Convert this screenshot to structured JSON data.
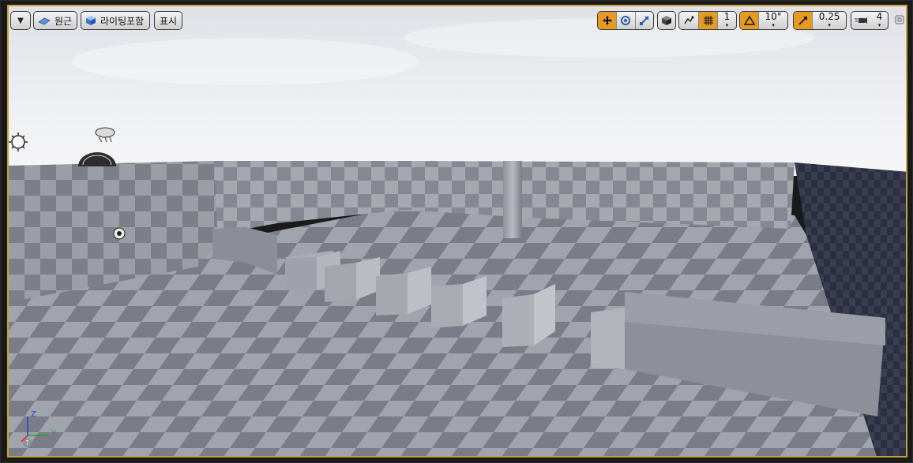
{
  "toolbar_left": {
    "menu_icon": "chevron-down-icon",
    "perspective_label": "원근",
    "lit_label": "라이팅포함",
    "show_label": "표시"
  },
  "toolbar_right": {
    "grid_snap_value": "1",
    "rotation_snap_value": "10°",
    "scale_snap_value": "0.25",
    "camera_speed_value": "4",
    "active_color": "#e59b21"
  },
  "axis_gizmo": {
    "z_label": "Z",
    "y_label": "Y",
    "help_icon": "question-icon"
  },
  "colors": {
    "frame_border": "#c8a13a",
    "sky_top": "#e2e4ea",
    "floor_dark": "#6e717d",
    "floor_light": "#9a9ca6"
  }
}
